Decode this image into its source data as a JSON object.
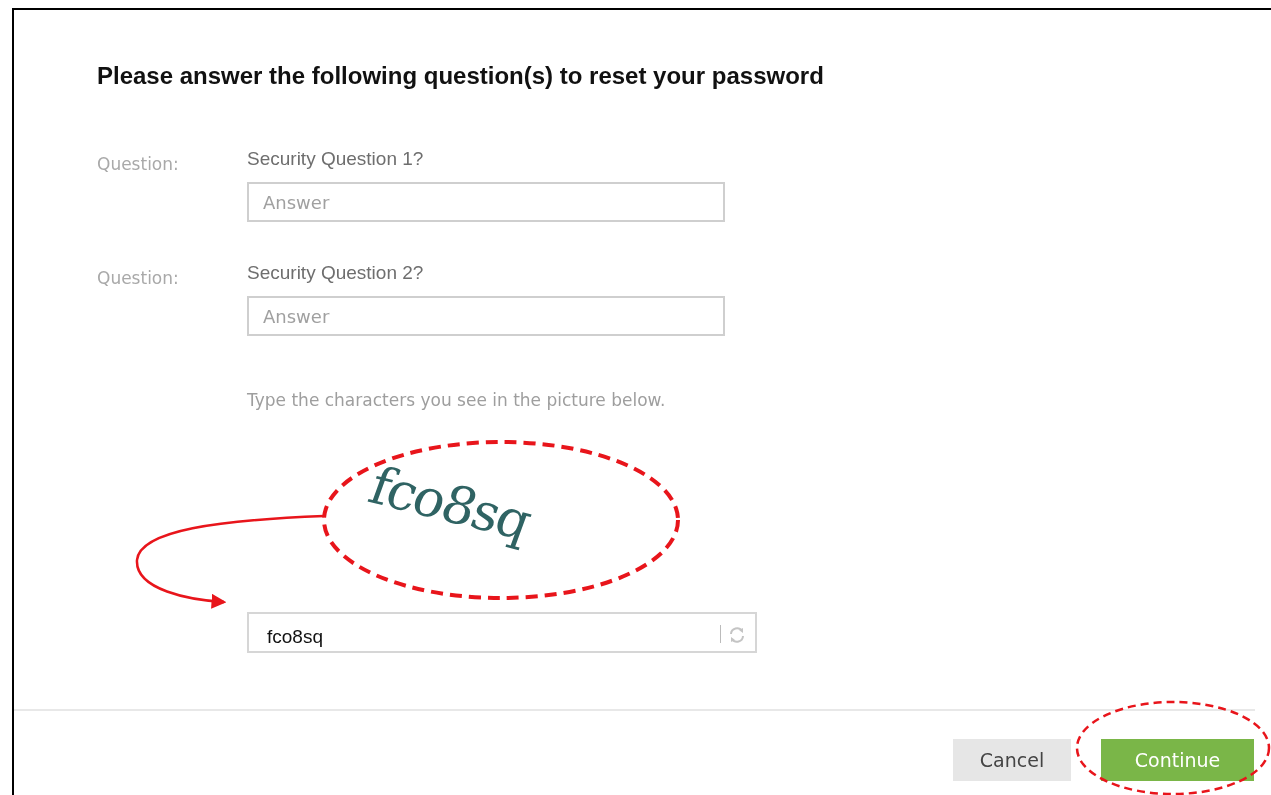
{
  "dialog": {
    "title": "Please answer the following question(s) to reset your password",
    "questions": [
      {
        "label": "Question:",
        "text": "Security Question 1?",
        "placeholder": "Answer"
      },
      {
        "label": "Question:",
        "text": "Security Question 2?",
        "placeholder": "Answer"
      }
    ],
    "captcha": {
      "hint": "Type the characters you see in the picture below.",
      "image_text": "fco8sq",
      "value": "fco8sq"
    },
    "buttons": [
      {
        "label": "Cancel",
        "kind": "secondary"
      },
      {
        "label": "Continue",
        "kind": "primary"
      }
    ]
  }
}
